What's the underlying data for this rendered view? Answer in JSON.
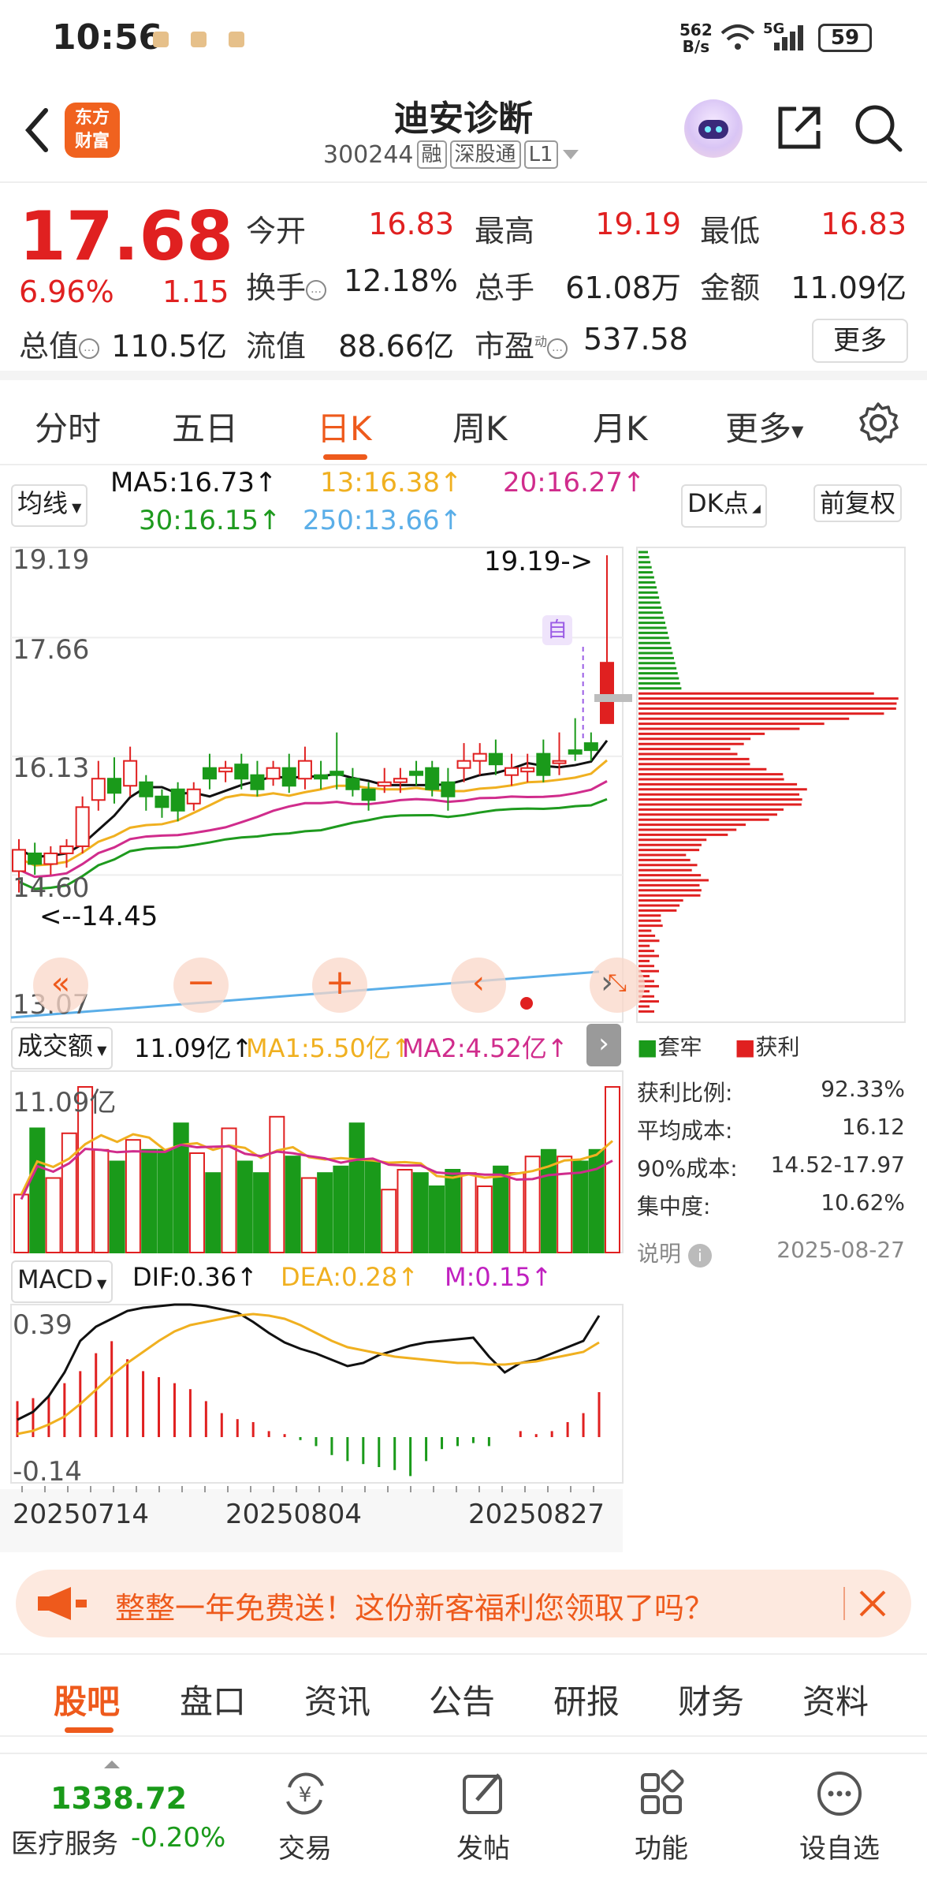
{
  "status_bar": {
    "time": "10:56",
    "net_speed_value": "562",
    "net_speed_unit": "B/s",
    "network": "5G",
    "battery": "59"
  },
  "header": {
    "logo_text_1": "东方",
    "logo_text_2": "财富",
    "stock_name": "迪安诊断",
    "stock_code": "300244",
    "tag_1": "融",
    "tag_2": "深股通",
    "tag_3": "L1"
  },
  "quote": {
    "price": "17.68",
    "change_pct": "6.96%",
    "change": "1.15",
    "open_label": "今开",
    "open": "16.83",
    "high_label": "最高",
    "high": "19.19",
    "low_label": "最低",
    "low": "16.83",
    "turnover_label": "换手",
    "turnover": "12.18%",
    "volume_label": "总手",
    "volume": "61.08万",
    "amount_label": "金额",
    "amount": "11.09亿",
    "mktcap_label": "总值",
    "mktcap": "110.5亿",
    "float_label": "流值",
    "float_cap": "88.66亿",
    "pe_label": "市盈",
    "pe_sup": "动",
    "pe": "537.58",
    "more_label": "更多"
  },
  "period_tabs": [
    "分时",
    "五日",
    "日K",
    "周K",
    "月K",
    "更多"
  ],
  "active_period": "日K",
  "kline": {
    "ma_selector": "均线",
    "ma5": "MA5:16.73↑",
    "ma13": "13:16.38↑",
    "ma20": "20:16.27↑",
    "ma30": "30:16.15↑",
    "ma250": "250:13.66↑",
    "dk_label": "DK点",
    "adj_label": "前复权",
    "y_labels": [
      "19.19",
      "17.66",
      "16.13",
      "14.60",
      "13.07"
    ],
    "high_marker": "19.19->",
    "low_marker": "<--14.45",
    "self_marker": "自"
  },
  "volume_panel": {
    "selector": "成交额",
    "value": "11.09亿↑",
    "ma1": "MA1:5.50亿↑",
    "ma2": "MA2:4.52亿↑",
    "y_top": "11.09亿"
  },
  "macd_panel": {
    "selector": "MACD",
    "dif": "DIF:0.36↑",
    "dea": "DEA:0.28↑",
    "m": "M:0.15↑",
    "y_top": "0.39",
    "y_bottom": "-0.14"
  },
  "dates": [
    "20250714",
    "20250804",
    "20250827"
  ],
  "chip": {
    "legend_trapped": "套牢",
    "legend_profit": "获利",
    "stats": [
      {
        "label": "获利比例:",
        "value": "92.33%"
      },
      {
        "label": "平均成本:",
        "value": "16.12"
      },
      {
        "label": "90%成本:",
        "value": "14.52-17.97"
      },
      {
        "label": "集中度:",
        "value": "10.62%"
      }
    ],
    "note_label": "说明",
    "date": "2025-08-27"
  },
  "banner": {
    "text": "整整一年免费送！这份新客福利您领取了吗？"
  },
  "sub_tabs": [
    "股吧",
    "盘口",
    "资讯",
    "公告",
    "研报",
    "财务",
    "资料"
  ],
  "bottom_nav": {
    "index_value": "1338.72",
    "index_name": "医疗服务",
    "index_change": "-0.20%",
    "items": [
      "交易",
      "发帖",
      "功能",
      "设自选"
    ]
  },
  "colors": {
    "up": "#e02020",
    "down": "#1a9a1a",
    "accent": "#ee5a1c",
    "ma5": "#111111",
    "ma13": "#f0b020",
    "ma20": "#d02c8c",
    "ma30": "#1e9a1e",
    "ma250": "#5aaee8"
  },
  "chart_data": {
    "type": "candlestick",
    "dates": [
      "20250714",
      "20250804",
      "20250827"
    ],
    "ylim": [
      13.07,
      19.19
    ],
    "y_ticks": [
      19.19,
      17.66,
      16.13,
      14.6,
      13.07
    ],
    "last_close": 17.68,
    "period_high": 19.19,
    "period_low": 14.45
  }
}
